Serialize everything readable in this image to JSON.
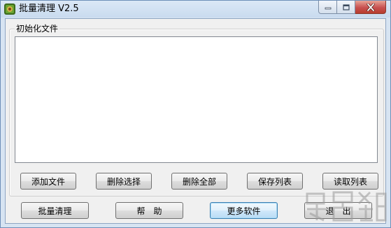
{
  "window": {
    "title": "批量清理 V2.5"
  },
  "group": {
    "caption": "初始化文件"
  },
  "list": {
    "items": []
  },
  "buttons": {
    "add_file": "添加文件",
    "delete_selected": "删除选择",
    "delete_all": "删除全部",
    "save_list": "保存列表",
    "read_list": "读取列表",
    "batch_clean": "批量清理",
    "help": "帮　助",
    "more_software": "更多软件",
    "exit": "退　出"
  },
  "colors": {
    "titlebar": "#c9dbef",
    "client_bg": "#f0f0f0",
    "close_button": "#c75050",
    "focus_border": "#3c7fb1"
  },
  "icons": {
    "app": "app-icon",
    "minimize": "minimize-icon",
    "maximize": "maximize-icon",
    "close": "close-icon"
  }
}
